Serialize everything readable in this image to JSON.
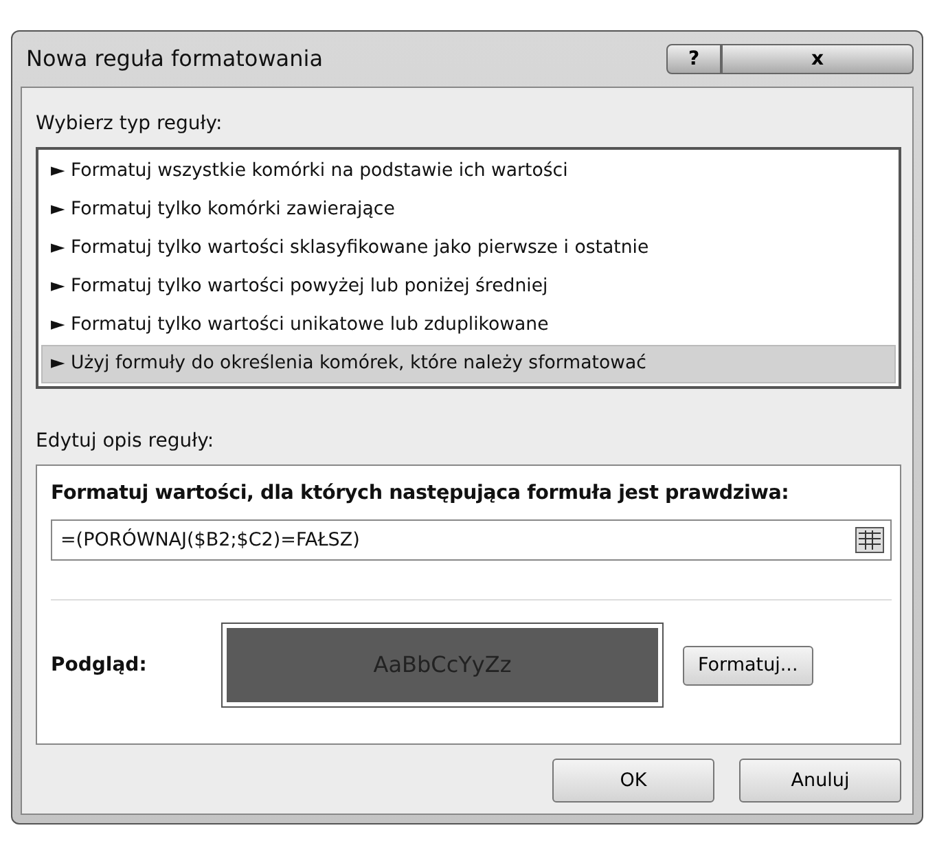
{
  "window": {
    "title": "Nowa reguła formatowania",
    "help_button": "?",
    "close_button": "x"
  },
  "rule_type": {
    "label": "Wybierz typ reguły:",
    "items": [
      {
        "label": "► Formatuj wszystkie komórki na podstawie ich wartości",
        "selected": false
      },
      {
        "label": "► Formatuj tylko komórki zawierające",
        "selected": false
      },
      {
        "label": "► Formatuj tylko wartości sklasyfikowane jako pierwsze i ostatnie",
        "selected": false
      },
      {
        "label": "► Formatuj tylko wartości powyżej lub poniżej średniej",
        "selected": false
      },
      {
        "label": "► Formatuj tylko wartości unikatowe lub zduplikowane",
        "selected": false
      },
      {
        "label": "► Użyj formuły do określenia komórek, które należy sformatować",
        "selected": true
      }
    ]
  },
  "description": {
    "label": "Edytuj opis reguły:",
    "heading": "Formatuj wartości, dla których następująca formuła jest prawdziwa:",
    "formula": "=(PORÓWNAJ($B2;$C2)=FAŁSZ)",
    "preview_label": "Podgląd:",
    "preview_text": "AaBbCcYyZz",
    "format_button": "Formatuj..."
  },
  "buttons": [
    "OK",
    "Anuluj"
  ]
}
